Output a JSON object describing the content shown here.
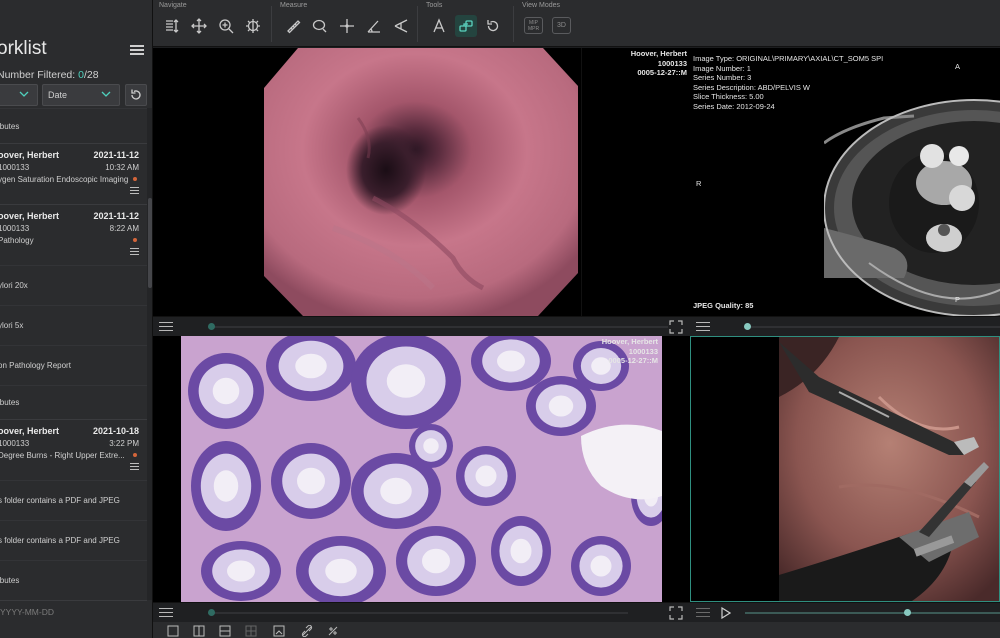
{
  "toolbar": {
    "groups": [
      {
        "label": "Navigate",
        "icons": [
          "stack-scroll-icon",
          "pan-icon",
          "zoom-icon",
          "window-level-icon"
        ]
      },
      {
        "label": "Measure",
        "icons": [
          "length-icon",
          "ellipse-roi-icon",
          "probe-icon",
          "angle-icon",
          "cobb-angle-icon"
        ]
      },
      {
        "label": "Tools",
        "icons": [
          "annotate-icon",
          "crosshairs-link-icon",
          "reset-icon"
        ]
      },
      {
        "label": "View Modes",
        "icons": [
          "mip-mpr-icon",
          "3d-icon"
        ]
      }
    ],
    "view_modes": {
      "mip_mpr": "MIP\nMPR",
      "three_d": "3D"
    }
  },
  "sidebar": {
    "title": "orklist",
    "filtered_label": "Number Filtered:",
    "filtered_count": "0",
    "filtered_total": "/28",
    "filter_left": "",
    "filter_right": "Date",
    "date_placeholder": "YYYY-MM-DD",
    "rows": [
      {
        "type": "sub",
        "text": "ibutes"
      },
      {
        "type": "study",
        "name": "oover, Herbert",
        "date": "2021-11-12",
        "mrn": "1000133",
        "time": "10:32 AM",
        "desc": "ygen Saturation Endoscopic Imaging"
      },
      {
        "type": "study",
        "name": "oover, Herbert",
        "date": "2021-11-12",
        "mrn": "1000133",
        "time": "8:22 AM",
        "desc": "Pathology"
      },
      {
        "type": "sub",
        "text": "ylori 20x"
      },
      {
        "type": "sub",
        "text": "ylori 5x"
      },
      {
        "type": "sub",
        "text": "on Pathology Report"
      },
      {
        "type": "sub",
        "text": "ibutes"
      },
      {
        "type": "study",
        "name": "oover, Herbert",
        "date": "2021-10-18",
        "mrn": "1000133",
        "time": "3:22 PM",
        "desc": "Degree Burns - Right Upper Extre..."
      },
      {
        "type": "sub",
        "text": "s folder contains a PDF and JPEG"
      },
      {
        "type": "sub",
        "text": "s folder contains a PDF and JPEG"
      },
      {
        "type": "sub",
        "text": "ibutes"
      }
    ]
  },
  "viewports": {
    "ct": {
      "patient": "Hoover, Herbert",
      "mrn": "1000133",
      "study_date": "0005-12-27::M",
      "info": [
        "Image Type: ORIGINAL\\PRIMARY\\AXIAL\\CT_SOM5 SPI",
        "Image Number: 1",
        "Series Number: 3",
        "Series Description: ABD/PELVIS W",
        "Slice Thickness: 5.00",
        "Series Date: 2012-09-24"
      ],
      "orient_top": "A",
      "orient_left": "R",
      "orient_bottom": "P",
      "quality": "JPEG Quality: 85"
    },
    "histo": {
      "patient": "Hoover, Herbert",
      "mrn": "1000133",
      "study_date": "0005-12-27::M"
    }
  },
  "colors": {
    "accent": "#4fd1bd",
    "status_dot": "#d3653a",
    "active_border": "#2f8f80"
  }
}
